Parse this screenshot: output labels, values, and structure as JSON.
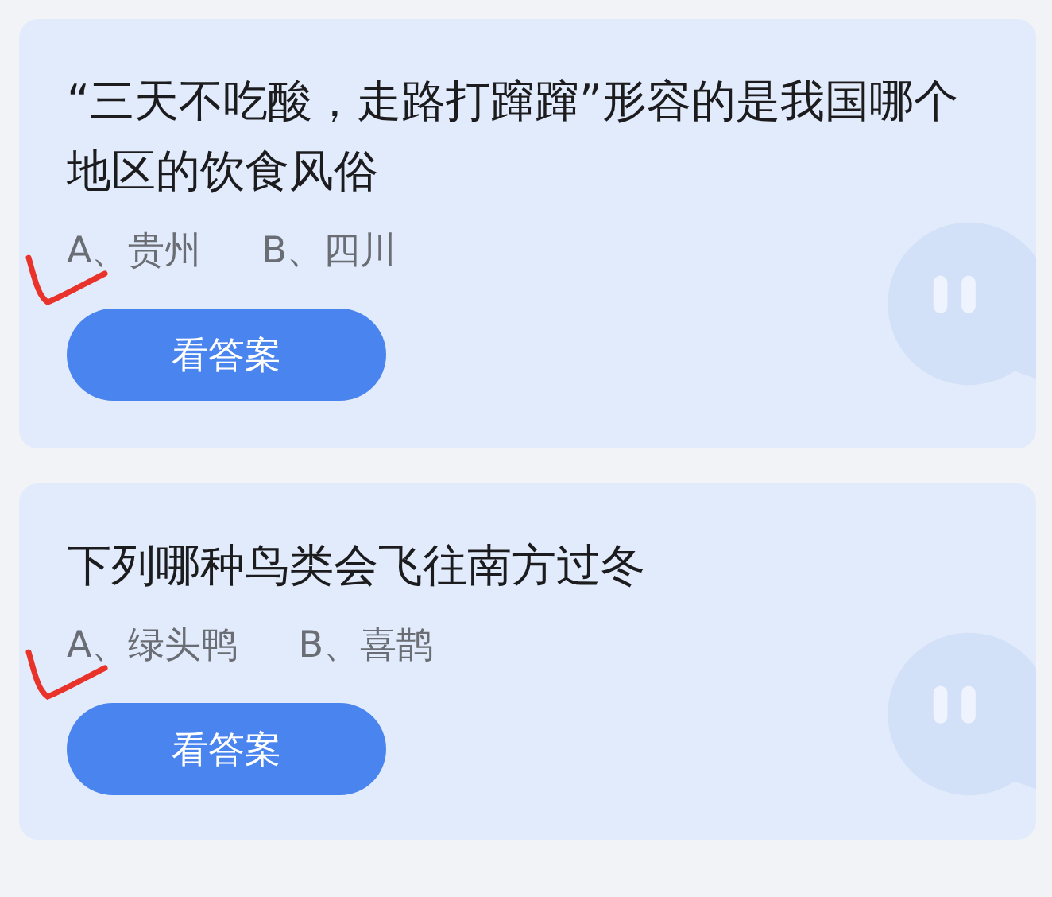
{
  "cards": [
    {
      "question": "“三天不吃酸，走路打蹿蹿”形容的是我国哪个地区的饮食风俗",
      "options": [
        {
          "text": "A、贵州",
          "marked": true
        },
        {
          "text": "B、四川",
          "marked": false
        }
      ],
      "button": "看答案"
    },
    {
      "question": "下列哪种鸟类会飞往南方过冬",
      "options": [
        {
          "text": "A、绿头鸭",
          "marked": true
        },
        {
          "text": "B、喜鹊",
          "marked": false
        }
      ],
      "button": "看答案"
    }
  ]
}
